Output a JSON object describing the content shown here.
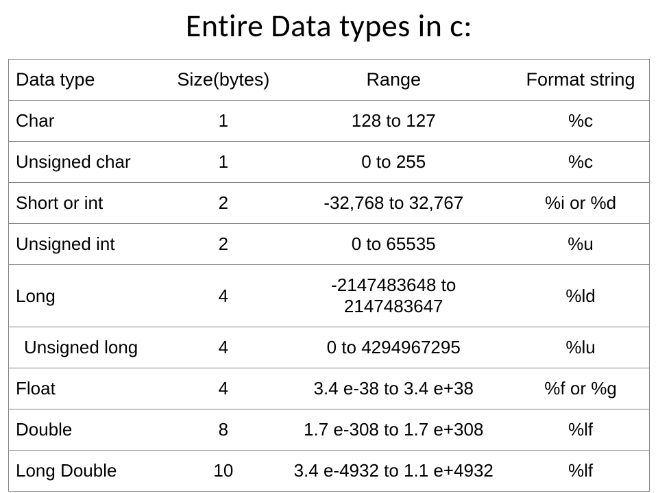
{
  "title": "Entire Data types in c:",
  "headers": {
    "c1": "Data type",
    "c2": "Size(bytes)",
    "c3": "Range",
    "c4": "Format string"
  },
  "rows": [
    {
      "c1": "Char",
      "c2": "1",
      "c3": "128 to 127",
      "c4": "%c"
    },
    {
      "c1": "Unsigned char",
      "c2": "1",
      "c3": "0 to 255",
      "c4": "%c"
    },
    {
      "c1": "Short or int",
      "c2": "2",
      "c3": "-32,768 to 32,767",
      "c4": "%i or %d"
    },
    {
      "c1": "Unsigned int",
      "c2": "2",
      "c3": "0 to 65535",
      "c4": "%u"
    },
    {
      "c1": "Long",
      "c2": "4",
      "c3": "-2147483648 to 2147483647",
      "c4": "%ld"
    },
    {
      "c1": " Unsigned long",
      "c2": "4",
      "c3": "0 to 4294967295",
      "c4": "%lu"
    },
    {
      "c1": "Float",
      "c2": "4",
      "c3": "3.4 e-38 to 3.4 e+38",
      "c4": "%f or %g"
    },
    {
      "c1": "Double",
      "c2": "8",
      "c3": "1.7 e-308 to 1.7 e+308",
      "c4": "%lf"
    },
    {
      "c1": "Long Double",
      "c2": "10",
      "c3": "3.4 e-4932 to 1.1 e+4932",
      "c4": "%lf"
    }
  ]
}
